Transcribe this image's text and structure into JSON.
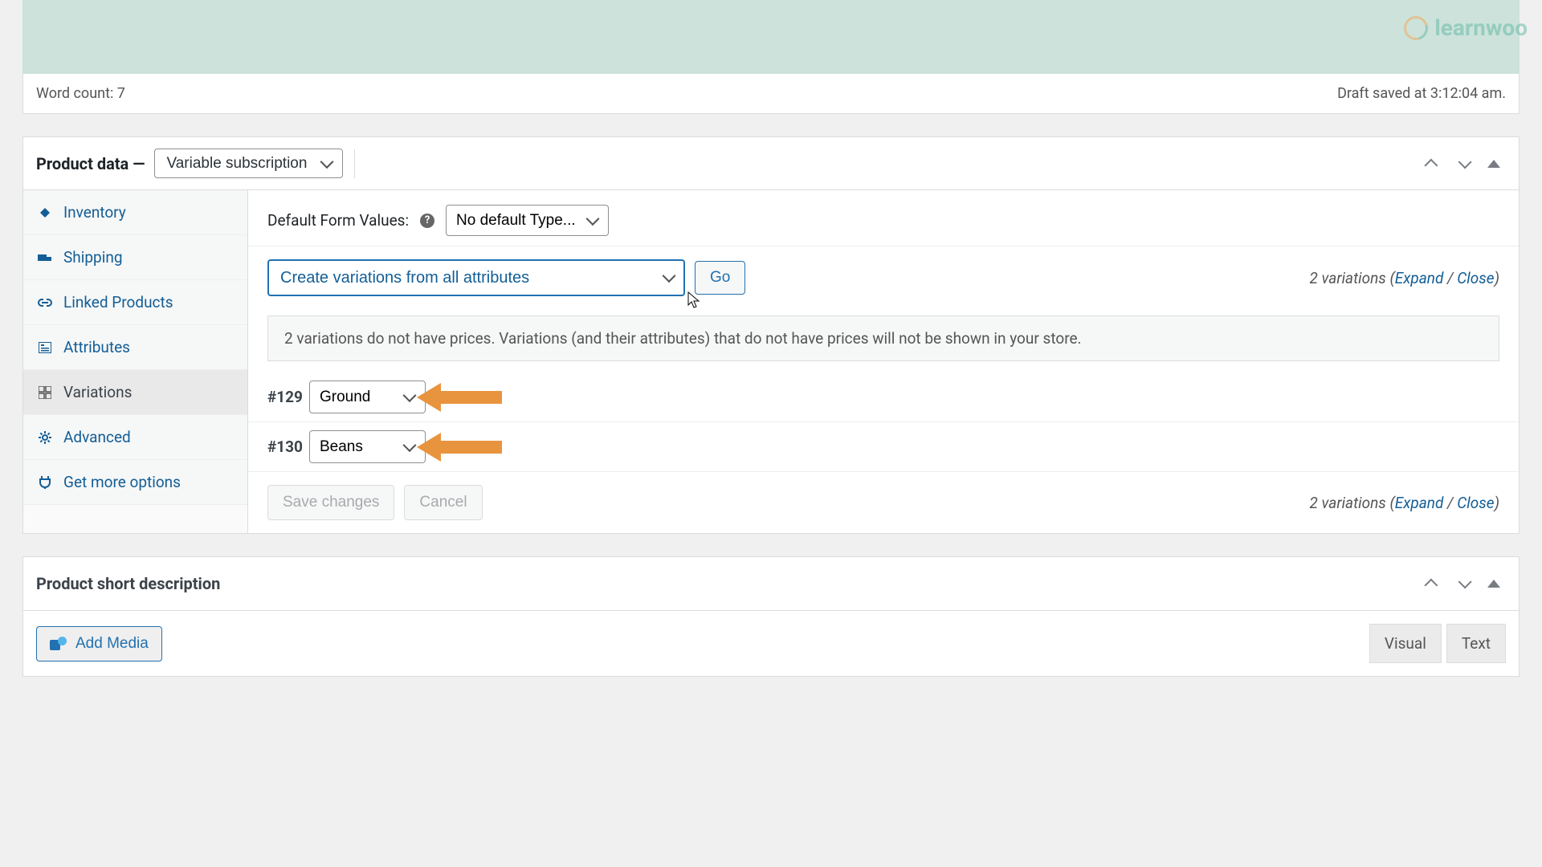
{
  "watermark": "learnwoo",
  "status_bar": {
    "word_count": "Word count: 7",
    "draft_saved": "Draft saved at 3:12:04 am."
  },
  "product_data": {
    "title_prefix": "Product data —",
    "type_selected": "Variable subscription",
    "tabs": {
      "inventory": "Inventory",
      "shipping": "Shipping",
      "linked": "Linked Products",
      "attributes": "Attributes",
      "variations": "Variations",
      "advanced": "Advanced",
      "more": "Get more options"
    },
    "default_form_values_label": "Default Form Values:",
    "default_type_selected": "No default Type...",
    "bulk_action_selected": "Create variations from all attributes",
    "go_label": "Go",
    "count_text": {
      "prefix": "2 variations (",
      "expand": "Expand",
      "sep": " / ",
      "close": "Close",
      "suffix": ")"
    },
    "notice": "2 variations do not have prices. Variations (and their attributes) that do not have prices will not be shown in your store.",
    "variations": [
      {
        "id": "#129",
        "value": "Ground"
      },
      {
        "id": "#130",
        "value": "Beans"
      }
    ],
    "save_label": "Save changes",
    "cancel_label": "Cancel"
  },
  "short_description": {
    "title": "Product short description",
    "add_media": "Add Media",
    "visual_tab": "Visual",
    "text_tab": "Text"
  }
}
